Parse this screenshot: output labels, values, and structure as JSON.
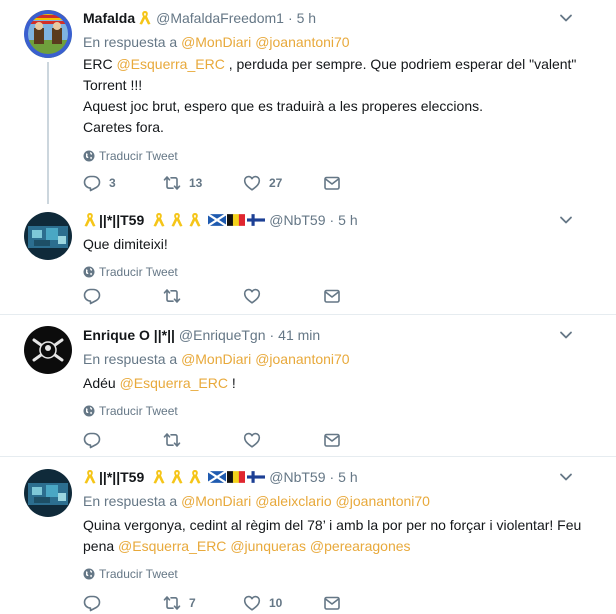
{
  "tweets": [
    {
      "name": "Mafalda",
      "handle": "@MafaldaFreedom1",
      "sep": "·",
      "time": "5 h",
      "reply_prefix": "En respuesta a",
      "reply_mentions": [
        "@MonDiari",
        "@joanantoni70"
      ],
      "text_l1_a": "ERC ",
      "text_l1_mention": "@Esquerra_ERC",
      "text_l1_b": " , perduda per sempre. Que podriem esperar del \"valent\"",
      "text_l2": "Torrent !!!",
      "text_l3": "Aquest joc brut, espero que es traduirà a les properes eleccions.",
      "text_l4": "Caretes fora.",
      "translate": "Traducir Tweet",
      "counts": {
        "reply": "3",
        "retweet": "13",
        "like": "27"
      }
    },
    {
      "name": "||*||T59",
      "handle": "@NbT59",
      "sep": "·",
      "time": "5 h",
      "text": "Que dimiteixi!",
      "translate": "Traducir Tweet",
      "counts": {
        "reply": "",
        "retweet": "",
        "like": ""
      }
    },
    {
      "name": "Enrique O ||*||",
      "handle": "@EnriqueTgn",
      "sep": "·",
      "time": "41 min",
      "reply_prefix": "En respuesta a",
      "reply_mentions": [
        "@MonDiari",
        "@joanantoni70"
      ],
      "text_a": "Adéu ",
      "text_mention": "@Esquerra_ERC",
      "text_b": " !",
      "translate": "Traducir Tweet",
      "counts": {
        "reply": "",
        "retweet": "",
        "like": ""
      }
    },
    {
      "name": "||*||T59",
      "handle": "@NbT59",
      "sep": "·",
      "time": "5 h",
      "reply_prefix": "En respuesta a",
      "reply_mentions": [
        "@MonDiari",
        "@aleixclario",
        "@joanantoni70"
      ],
      "text_l1": "Quina vergonya, cedint al règim del 78’  i amb la por per no forçar i violentar! Feu",
      "text_l2_a": "pena ",
      "text_l2_mentions": [
        "@Esquerra_ERC",
        "@junqueras",
        "@perearagones"
      ],
      "translate": "Traducir Tweet",
      "counts": {
        "reply": "",
        "retweet": "7",
        "like": "10"
      }
    }
  ],
  "colors": {
    "mention": "#e8a93b",
    "muted": "#657786",
    "divider": "#e6ecf0",
    "ribbon": "#f5c518"
  },
  "icons": [
    "ribbon-icon",
    "caret-down-icon",
    "globe-icon",
    "reply-icon",
    "retweet-icon",
    "like-icon",
    "direct-message-icon",
    "scotland-flag-icon",
    "belgium-flag-icon",
    "finland-flag-icon"
  ]
}
